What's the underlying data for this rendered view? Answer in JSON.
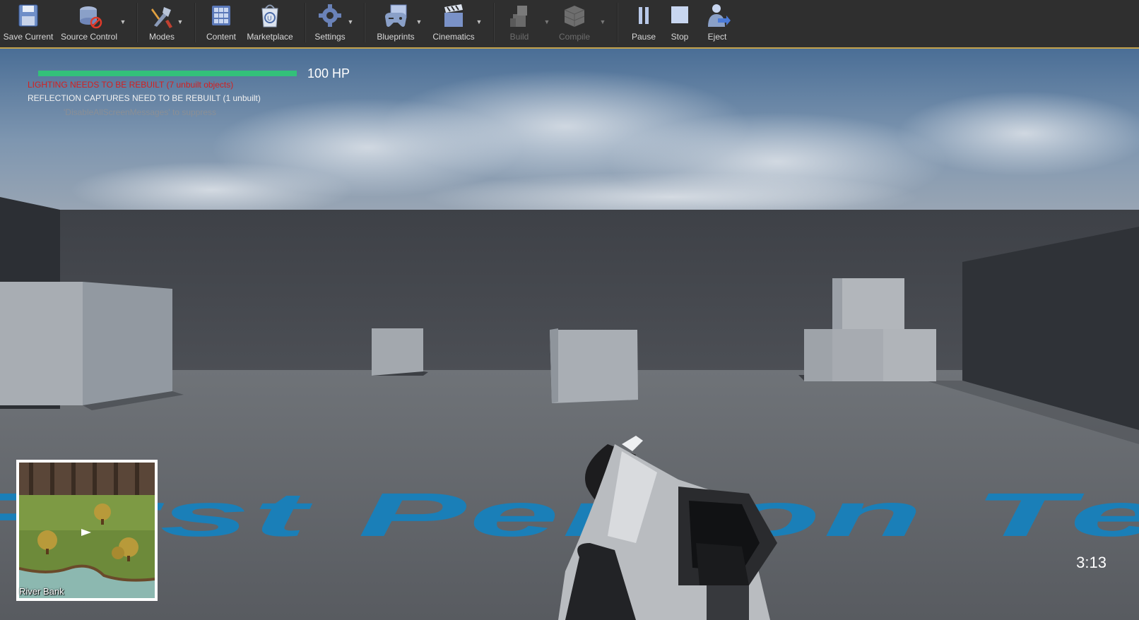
{
  "toolbar": {
    "save_current": "Save Current",
    "source_control": "Source Control",
    "modes": "Modes",
    "content": "Content",
    "marketplace": "Marketplace",
    "settings": "Settings",
    "blueprints": "Blueprints",
    "cinematics": "Cinematics",
    "build": "Build",
    "compile": "Compile",
    "pause": "Pause",
    "stop": "Stop",
    "eject": "Eject"
  },
  "hud": {
    "hp_text": "100 HP",
    "hp_fraction": 1.0,
    "timer": "3:13"
  },
  "messages": {
    "lighting": "LIGHTING NEEDS TO BE REBUILT (7 unbuilt objects)",
    "reflection": "REFLECTION CAPTURES NEED TO BE REBUILT (1 unbuilt)",
    "suppress": "'DisableAllScreenMessages' to suppress"
  },
  "minimap": {
    "location": "River Bank"
  },
  "floor_text": "First Person Template",
  "colors": {
    "hp_fill": "#33c07a",
    "warning": "#d42020",
    "floor_text": "#1a7fb8",
    "toolbar_bg": "#2f2f2f"
  }
}
